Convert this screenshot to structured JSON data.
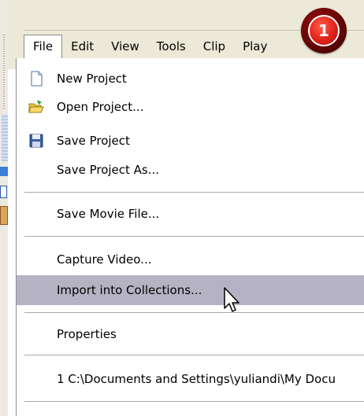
{
  "menubar": {
    "items": [
      "File",
      "Edit",
      "View",
      "Tools",
      "Clip",
      "Play"
    ]
  },
  "badge": {
    "number": "1"
  },
  "file_menu": {
    "new_project": "New Project",
    "open_project": "Open Project...",
    "save_project": "Save Project",
    "save_project_as": "Save Project As...",
    "save_movie_file": "Save Movie File...",
    "capture_video": "Capture Video...",
    "import_into_collections": "Import into Collections...",
    "properties": "Properties",
    "recent_1": "1 C:\\Documents and Settings\\yuliandi\\My Docu"
  },
  "colors": {
    "menu_background": "#ece9d8",
    "highlight": "#b4b2c3",
    "badge_red": "#e0231b"
  },
  "icons": [
    "new-project-icon",
    "open-folder-icon",
    "save-disk-icon",
    "mouse-cursor-icon"
  ]
}
